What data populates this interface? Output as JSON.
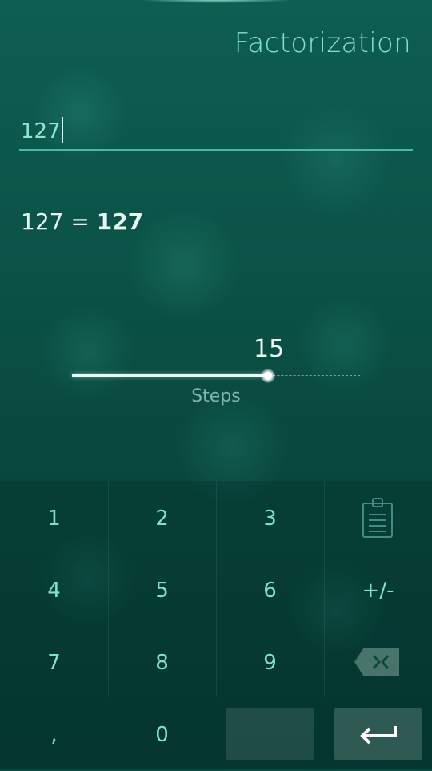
{
  "header": {
    "title": "Factorization"
  },
  "input": {
    "value": "127"
  },
  "result": {
    "lhs": "127 = ",
    "rhs": "127"
  },
  "slider": {
    "value": "15",
    "label": "Steps",
    "fraction": 0.68
  },
  "keypad": {
    "keys": [
      "1",
      "2",
      "3",
      "4",
      "5",
      "6",
      "+/-",
      "7",
      "8",
      "9",
      ",",
      "0"
    ],
    "icons": {
      "paste": "clipboard-icon",
      "backspace": "backspace-icon",
      "enter": "enter-icon"
    }
  },
  "colors": {
    "accent": "#7fe3cc",
    "text": "#e6f5f0",
    "muted": "#7fb7ad"
  }
}
